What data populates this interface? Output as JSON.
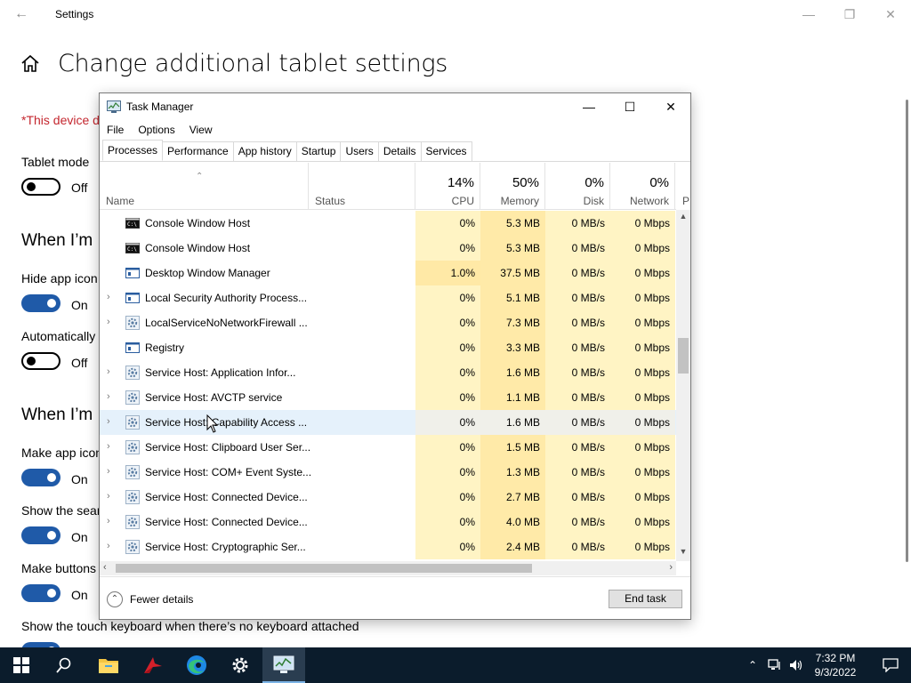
{
  "settings": {
    "window_title": "Settings",
    "heading": "Change additional tablet settings",
    "warning": "*This device do",
    "tablet_mode_label": "Tablet mode",
    "tablet_mode_state": "Off",
    "section1": "When I’m",
    "hide_icons_label": "Hide app icon",
    "hide_icons_state": "On",
    "auto_label": "Automatically",
    "auto_state": "Off",
    "section2": "When I’m",
    "make_icons_label": "Make app icon",
    "make_icons_state": "On",
    "show_search_label": "Show the sear",
    "show_search_state": "On",
    "make_buttons_label": "Make buttons",
    "make_buttons_state": "On",
    "touch_kb_label": "Show the touch keyboard when there’s no keyboard attached"
  },
  "taskmgr": {
    "title": "Task Manager",
    "menu": [
      "File",
      "Options",
      "View"
    ],
    "tabs": [
      "Processes",
      "Performance",
      "App history",
      "Startup",
      "Users",
      "Details",
      "Services"
    ],
    "active_tab": "Processes",
    "columns": {
      "name": "Name",
      "status": "Status",
      "cpu": {
        "pct": "14%",
        "label": "CPU"
      },
      "memory": {
        "pct": "50%",
        "label": "Memory"
      },
      "disk": {
        "pct": "0%",
        "label": "Disk"
      },
      "network": {
        "pct": "0%",
        "label": "Network"
      },
      "power_partial": "P"
    },
    "rows": [
      {
        "name": "Console Window Host",
        "expandable": false,
        "icon": "console-icon",
        "cpu": "0%",
        "mem": "5.3 MB",
        "disk": "0 MB/s",
        "net": "0 Mbps"
      },
      {
        "name": "Console Window Host",
        "expandable": false,
        "icon": "console-icon",
        "cpu": "0%",
        "mem": "5.3 MB",
        "disk": "0 MB/s",
        "net": "0 Mbps"
      },
      {
        "name": "Desktop Window Manager",
        "expandable": false,
        "icon": "window-icon",
        "cpu": "1.0%",
        "mem": "37.5 MB",
        "disk": "0 MB/s",
        "net": "0 Mbps"
      },
      {
        "name": "Local Security Authority Process...",
        "expandable": true,
        "icon": "window-icon",
        "cpu": "0%",
        "mem": "5.1 MB",
        "disk": "0 MB/s",
        "net": "0 Mbps"
      },
      {
        "name": "LocalServiceNoNetworkFirewall ...",
        "expandable": true,
        "icon": "gear-icon",
        "cpu": "0%",
        "mem": "7.3 MB",
        "disk": "0 MB/s",
        "net": "0 Mbps"
      },
      {
        "name": "Registry",
        "expandable": false,
        "icon": "window-icon",
        "cpu": "0%",
        "mem": "3.3 MB",
        "disk": "0 MB/s",
        "net": "0 Mbps"
      },
      {
        "name": "Service Host: Application Infor...",
        "expandable": true,
        "icon": "gear-icon",
        "cpu": "0%",
        "mem": "1.6 MB",
        "disk": "0 MB/s",
        "net": "0 Mbps"
      },
      {
        "name": "Service Host: AVCTP service",
        "expandable": true,
        "icon": "gear-icon",
        "cpu": "0%",
        "mem": "1.1 MB",
        "disk": "0 MB/s",
        "net": "0 Mbps"
      },
      {
        "name": "Service Host: Capability Access ...",
        "expandable": true,
        "icon": "gear-icon",
        "cpu": "0%",
        "mem": "1.6 MB",
        "disk": "0 MB/s",
        "net": "0 Mbps"
      },
      {
        "name": "Service Host: Clipboard User Ser...",
        "expandable": true,
        "icon": "gear-icon",
        "cpu": "0%",
        "mem": "1.5 MB",
        "disk": "0 MB/s",
        "net": "0 Mbps"
      },
      {
        "name": "Service Host: COM+ Event Syste...",
        "expandable": true,
        "icon": "gear-icon",
        "cpu": "0%",
        "mem": "1.3 MB",
        "disk": "0 MB/s",
        "net": "0 Mbps"
      },
      {
        "name": "Service Host: Connected Device...",
        "expandable": true,
        "icon": "gear-icon",
        "cpu": "0%",
        "mem": "2.7 MB",
        "disk": "0 MB/s",
        "net": "0 Mbps"
      },
      {
        "name": "Service Host: Connected Device...",
        "expandable": true,
        "icon": "gear-icon",
        "cpu": "0%",
        "mem": "4.0 MB",
        "disk": "0 MB/s",
        "net": "0 Mbps"
      },
      {
        "name": "Service Host: Cryptographic Ser...",
        "expandable": true,
        "icon": "gear-icon",
        "cpu": "0%",
        "mem": "2.4 MB",
        "disk": "0 MB/s",
        "net": "0 Mbps"
      }
    ],
    "fewer_details": "Fewer details",
    "end_task": "End task"
  },
  "taskbar": {
    "time": "7:32 PM",
    "date": "9/3/2022",
    "items": [
      "start-icon",
      "search-icon",
      "file-explorer-icon",
      "app-icon",
      "edge-icon",
      "settings-gear-icon",
      "task-manager-icon"
    ]
  },
  "colors": {
    "accent_toggle": "#1f5aa8",
    "warning": "#c4262e",
    "heat_light": "#fff4c4",
    "heat_mem": "#ffeaa8",
    "taskbar": "#0b1c2c"
  }
}
